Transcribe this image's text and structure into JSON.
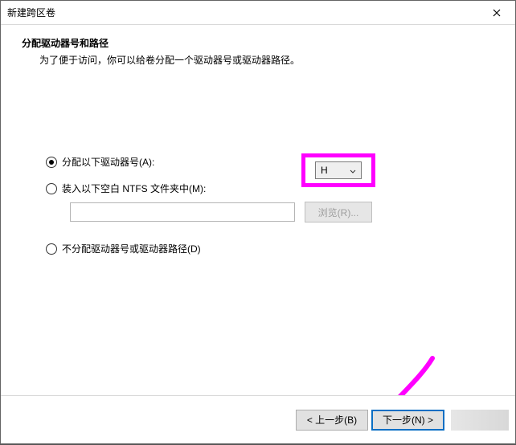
{
  "window": {
    "title": "新建跨区卷"
  },
  "page": {
    "heading": "分配驱动器号和路径",
    "subheading": "为了便于访问，你可以给卷分配一个驱动器号或驱动器路径。"
  },
  "options": {
    "assign_letter": {
      "label": "分配以下驱动器号(A):",
      "selected_drive": "H"
    },
    "mount_folder": {
      "label": "装入以下空白 NTFS 文件夹中(M):",
      "path_value": "",
      "browse_label": "浏览(R)..."
    },
    "no_assign": {
      "label": "不分配驱动器号或驱动器路径(D)"
    }
  },
  "footer": {
    "back": "< 上一步(B)",
    "next": "下一步(N) >"
  },
  "colors": {
    "highlight": "#ff00ff",
    "primary_border": "#0b6fc4"
  }
}
